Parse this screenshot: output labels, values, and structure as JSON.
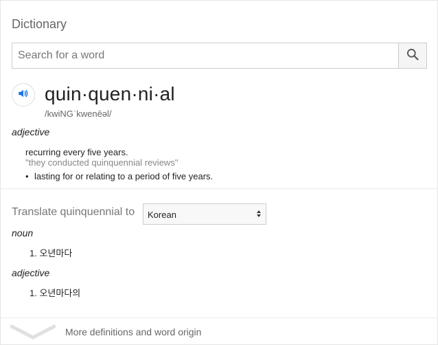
{
  "widget": {
    "title": "Dictionary",
    "search": {
      "placeholder": "Search for a word",
      "value": ""
    }
  },
  "entry": {
    "headword": "quin·quen·ni·al",
    "phonetic": "/kwiNGˈkwenēəl/",
    "part_of_speech": "adjective",
    "definition": "recurring every five years.",
    "example": "\"they conducted quinquennial reviews\"",
    "sub_definitions": [
      "lasting for or relating to a period of five years."
    ]
  },
  "translate": {
    "label": "Translate quinquennial to",
    "language": "Korean",
    "groups": [
      {
        "part_of_speech": "noun",
        "items": [
          "1. 오년마다"
        ]
      },
      {
        "part_of_speech": "adjective",
        "items": [
          "1. 오년마다의"
        ]
      }
    ]
  },
  "footer": {
    "more_label": "More definitions and word origin"
  },
  "icons": {
    "search": "search-icon",
    "audio": "speaker-icon",
    "select_arrows": "updown-arrows-icon",
    "more": "chevron-down-icon"
  },
  "colors": {
    "accent_blue": "#1a73e8",
    "muted_text": "#777777"
  }
}
